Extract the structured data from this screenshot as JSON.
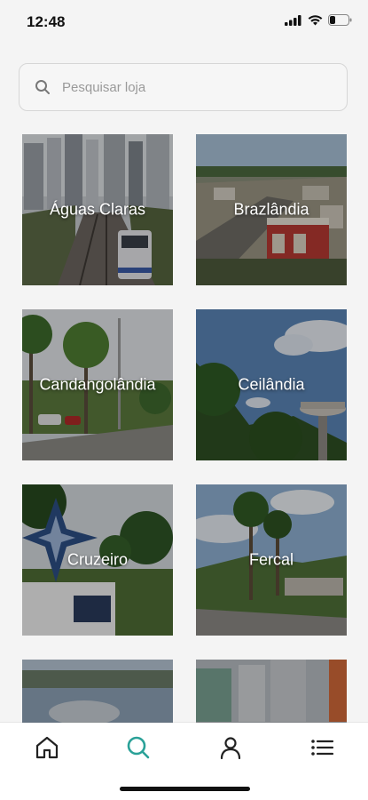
{
  "status": {
    "time": "12:48"
  },
  "search": {
    "placeholder": "Pesquisar loja"
  },
  "cities": [
    {
      "name": "Águas Claras"
    },
    {
      "name": "Brazlândia"
    },
    {
      "name": "Candangolândia"
    },
    {
      "name": "Ceilândia"
    },
    {
      "name": "Cruzeiro"
    },
    {
      "name": "Fercal"
    },
    {
      "name": ""
    },
    {
      "name": ""
    }
  ],
  "tabs": [
    {
      "icon": "home-icon",
      "active": false
    },
    {
      "icon": "search-icon",
      "active": true
    },
    {
      "icon": "user-icon",
      "active": false
    },
    {
      "icon": "menu-list-icon",
      "active": false
    }
  ],
  "colors": {
    "accent": "#2aa198",
    "background": "#f4f4f4",
    "tab_inactive": "#222222"
  }
}
